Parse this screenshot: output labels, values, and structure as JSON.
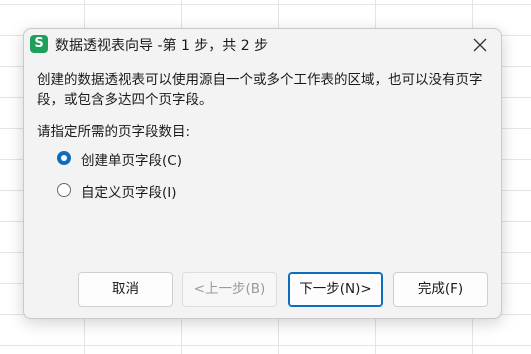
{
  "dialog": {
    "title": "数据透视表向导 -第 1 步，共 2 步",
    "app_icon_letter": "S",
    "description": "创建的数据透视表可以使用源自一个或多个工作表的区域，也可以没有页字段，或包含多达四个页字段。",
    "prompt": "请指定所需的页字段数目:",
    "options": [
      {
        "label": "创建单页字段(C)",
        "selected": true
      },
      {
        "label": "自定义页字段(I)",
        "selected": false
      }
    ],
    "buttons": {
      "cancel": "取消",
      "prev": "<上一步(B)",
      "next": "下一步(N)>",
      "finish": "完成(F)"
    },
    "colors": {
      "accent": "#0f6cbd",
      "app_icon": "#1f9f5b"
    },
    "icons": {
      "app": "spreadsheet-app-icon",
      "close": "close-icon"
    }
  }
}
